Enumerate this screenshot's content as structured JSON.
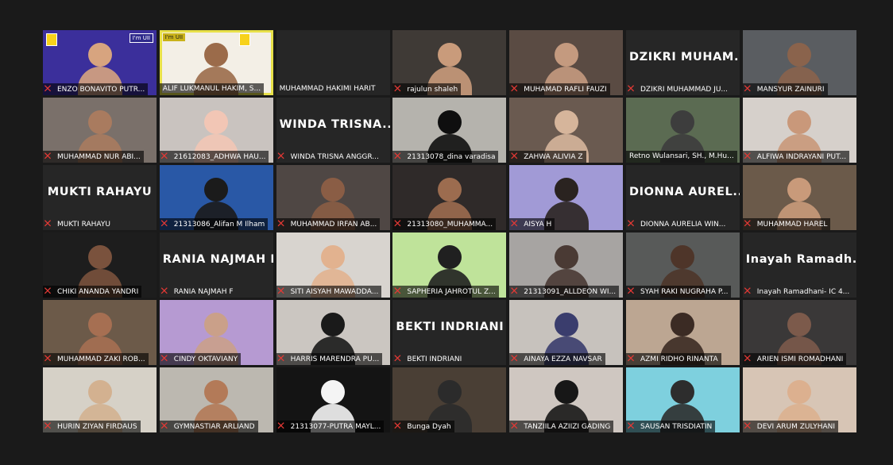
{
  "participants": [
    {
      "name": "ENZO BONAVITO PUTR...",
      "muted": true,
      "video": true,
      "bg": "#3b2f9b",
      "skin": "#d7a47f",
      "badge": "I'm UII"
    },
    {
      "name": "ALIF LUKMANUL HAKIM, S...",
      "muted": false,
      "video": true,
      "bg": "#f3efe6",
      "skin": "#9b6b4a",
      "speaking": true,
      "badge": "I'm UII"
    },
    {
      "name": "MUHAMMAD HAKIMI HARIT",
      "muted": false,
      "video": false
    },
    {
      "name": "rajulun shaleh",
      "muted": true,
      "video": true,
      "bg": "#3f3a36",
      "skin": "#c99b7b"
    },
    {
      "name": "MUHAMAD RAFLI FAUZI",
      "muted": true,
      "video": true,
      "bg": "#5a4b43",
      "skin": "#c49a7f"
    },
    {
      "name": "DZIKRI MUHAMMAD JU...",
      "muted": true,
      "video": false,
      "big": "DZIKRI MUHAM..."
    },
    {
      "name": "MANSYUR ZAINURI",
      "muted": true,
      "video": true,
      "bg": "#5a5d61",
      "skin": "#8a634c"
    },
    {
      "name": "MUHAMMAD NUR ABI...",
      "muted": true,
      "video": true,
      "bg": "#7a706a",
      "skin": "#a97b5f"
    },
    {
      "name": "21612083_ADHWA HAU...",
      "muted": true,
      "video": true,
      "bg": "#c9c3bf",
      "skin": "#f2c6b5"
    },
    {
      "name": "WINDA TRISNA ANGGR...",
      "muted": true,
      "video": false,
      "big": "WINDA TRISNA..."
    },
    {
      "name": "21313078_dina varadisa",
      "muted": true,
      "video": true,
      "bg": "#b5b3ad",
      "skin": "#0f0f0f"
    },
    {
      "name": "ZAHWA ALIVIA Z",
      "muted": true,
      "video": true,
      "bg": "#6a5a50",
      "skin": "#d6b59b"
    },
    {
      "name": "Retno Wulansari, SH., M.Hu...",
      "muted": false,
      "video": true,
      "bg": "#5b6b52",
      "skin": "#3d3d3d"
    },
    {
      "name": "ALFIWA INDRAYANI PUT...",
      "muted": true,
      "video": true,
      "bg": "#d6d0cb",
      "skin": "#c9987a"
    },
    {
      "name": "MUKTI RAHAYU",
      "muted": true,
      "video": false,
      "big": "MUKTI RAHAYU"
    },
    {
      "name": "21313086_Alifan M Ilham",
      "muted": true,
      "video": true,
      "bg": "#2958a6",
      "skin": "#1b1b1b"
    },
    {
      "name": "MUHAMMAD IRFAN AB...",
      "muted": true,
      "video": true,
      "bg": "#4f4744",
      "skin": "#8a5d45"
    },
    {
      "name": "21313080_MUHAMMA...",
      "muted": true,
      "video": true,
      "bg": "#2f2a29",
      "skin": "#9c6c4f"
    },
    {
      "name": "AISYA H",
      "muted": true,
      "video": true,
      "bg": "#a19ad6",
      "skin": "#2a2320"
    },
    {
      "name": "DIONNA AURELIA WIN...",
      "muted": true,
      "video": false,
      "big": "DIONNA AUREL..."
    },
    {
      "name": "MUHAMMAD HAREL",
      "muted": true,
      "video": true,
      "bg": "#6b5a4a",
      "skin": "#c99a7a"
    },
    {
      "name": "CHIKI ANANDA YANDRI",
      "muted": true,
      "video": true,
      "bg": "#1d1d1d",
      "skin": "#7a523d"
    },
    {
      "name": "RANIA NAJMAH F",
      "muted": true,
      "video": false,
      "big": "RANIA NAJMAH F"
    },
    {
      "name": "SITI AISYAH MAWADDA...",
      "muted": true,
      "video": true,
      "bg": "#d8d4cf",
      "skin": "#e2b28f"
    },
    {
      "name": "SAPHERIA JAHROTUL Z...",
      "muted": true,
      "video": true,
      "bg": "#bfe39a",
      "skin": "#202020"
    },
    {
      "name": "21313091_ALLDEON WI...",
      "muted": true,
      "video": true,
      "bg": "#a7a4a2",
      "skin": "#4a3a34"
    },
    {
      "name": "SYAH RAKI NUGRAHA P...",
      "muted": true,
      "video": true,
      "bg": "#585a59",
      "skin": "#4e3529"
    },
    {
      "name": "Inayah Ramadhani- IC 4...",
      "muted": true,
      "video": false,
      "big": "Inayah Ramadh..."
    },
    {
      "name": "MUHAMMAD ZAKI ROB...",
      "muted": true,
      "video": true,
      "bg": "#6c5a49",
      "skin": "#a66f52"
    },
    {
      "name": "CINDY OKTAVIANY",
      "muted": true,
      "video": true,
      "bg": "#b69ad2",
      "skin": "#caa089"
    },
    {
      "name": "HARRIS MARENDRA PU...",
      "muted": true,
      "video": true,
      "bg": "#cbc6c1",
      "skin": "#1a1a1a"
    },
    {
      "name": "BEKTI INDRIANI",
      "muted": true,
      "video": false,
      "big": "BEKTI INDRIANI"
    },
    {
      "name": "AINAYA EZZA NAVSAR",
      "muted": true,
      "video": true,
      "bg": "#c7c2bd",
      "skin": "#3a3d6d"
    },
    {
      "name": "AZMI RIDHO RINANTA",
      "muted": true,
      "video": true,
      "bg": "#bca692",
      "skin": "#3b2b24"
    },
    {
      "name": "ARIEN ISMI ROMADHANI",
      "muted": true,
      "video": true,
      "bg": "#3a3838",
      "skin": "#7c5a4b"
    },
    {
      "name": "HURIN ZIYAN FIRDAUS",
      "muted": true,
      "video": true,
      "bg": "#d6d1c7",
      "skin": "#d3b190"
    },
    {
      "name": "GYMNASTIAR ARLIAND",
      "muted": true,
      "video": true,
      "bg": "#bcb8b0",
      "skin": "#b37a58"
    },
    {
      "name": "21313077-PUTRA MAYL...",
      "muted": true,
      "video": true,
      "bg": "#141414",
      "skin": "#f4f4f4"
    },
    {
      "name": "Bunga Dyah",
      "muted": true,
      "video": true,
      "bg": "#4a3f35",
      "skin": "#2b2b2b"
    },
    {
      "name": "TANZIILA AZIIZI GADING",
      "muted": true,
      "video": true,
      "bg": "#cfc7c1",
      "skin": "#171717"
    },
    {
      "name": "SAUSAN TRISDIATIN",
      "muted": true,
      "video": true,
      "bg": "#7ed0de",
      "skin": "#2d2d2d"
    },
    {
      "name": "DEVI ARUM ZULYHANI",
      "muted": true,
      "video": true,
      "bg": "#d7c5b5",
      "skin": "#dcb08f"
    }
  ]
}
